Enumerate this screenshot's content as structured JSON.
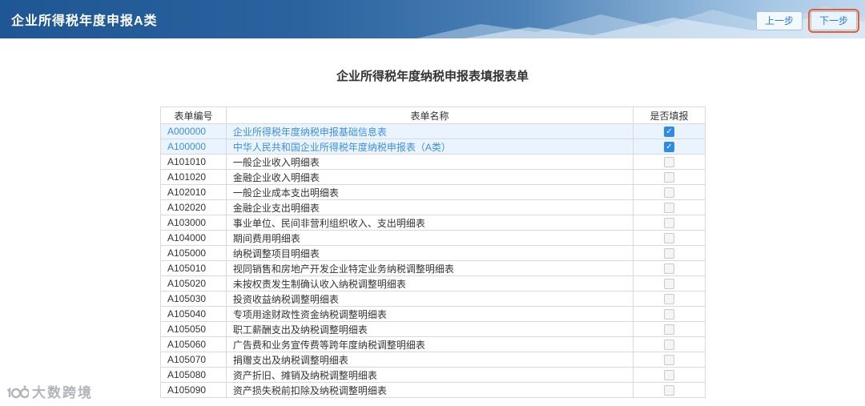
{
  "header": {
    "title": "企业所得税年度申报A类",
    "prev_button": "上一步",
    "next_button": "下一步"
  },
  "page": {
    "title": "企业所得税年度纳税申报表填报表单"
  },
  "table": {
    "columns": [
      "表单编号",
      "表单名称",
      "是否填报"
    ],
    "rows": [
      {
        "code": "A000000",
        "name": "企业所得税年度纳税申报基础信息表",
        "checked": true,
        "highlighted": true
      },
      {
        "code": "A100000",
        "name": "中华人民共和国企业所得税年度纳税申报表（A类）",
        "checked": true,
        "highlighted": true
      },
      {
        "code": "A101010",
        "name": "一般企业收入明细表",
        "checked": false,
        "highlighted": false
      },
      {
        "code": "A101020",
        "name": "金融企业收入明细表",
        "checked": false,
        "highlighted": false
      },
      {
        "code": "A102010",
        "name": "一般企业成本支出明细表",
        "checked": false,
        "highlighted": false
      },
      {
        "code": "A102020",
        "name": "金融企业支出明细表",
        "checked": false,
        "highlighted": false
      },
      {
        "code": "A103000",
        "name": "事业单位、民间非营利组织收入、支出明细表",
        "checked": false,
        "highlighted": false
      },
      {
        "code": "A104000",
        "name": "期间费用明细表",
        "checked": false,
        "highlighted": false
      },
      {
        "code": "A105000",
        "name": "纳税调整项目明细表",
        "checked": false,
        "highlighted": false
      },
      {
        "code": "A105010",
        "name": "视同销售和房地产开发企业特定业务纳税调整明细表",
        "checked": false,
        "highlighted": false
      },
      {
        "code": "A105020",
        "name": "未按权责发生制确认收入纳税调整明细表",
        "checked": false,
        "highlighted": false
      },
      {
        "code": "A105030",
        "name": "投资收益纳税调整明细表",
        "checked": false,
        "highlighted": false
      },
      {
        "code": "A105040",
        "name": "专项用途财政性资金纳税调整明细表",
        "checked": false,
        "highlighted": false
      },
      {
        "code": "A105050",
        "name": "职工薪酬支出及纳税调整明细表",
        "checked": false,
        "highlighted": false
      },
      {
        "code": "A105060",
        "name": "广告费和业务宣传费等跨年度纳税调整明细表",
        "checked": false,
        "highlighted": false
      },
      {
        "code": "A105070",
        "name": "捐赠支出及纳税调整明细表",
        "checked": false,
        "highlighted": false
      },
      {
        "code": "A105080",
        "name": "资产折旧、摊销及纳税调整明细表",
        "checked": false,
        "highlighted": false
      },
      {
        "code": "A105090",
        "name": "资产损失税前扣除及纳税调整明细表",
        "checked": false,
        "highlighted": false
      }
    ]
  },
  "watermark": {
    "text": "大数跨境",
    "check_glyph": "✓"
  }
}
